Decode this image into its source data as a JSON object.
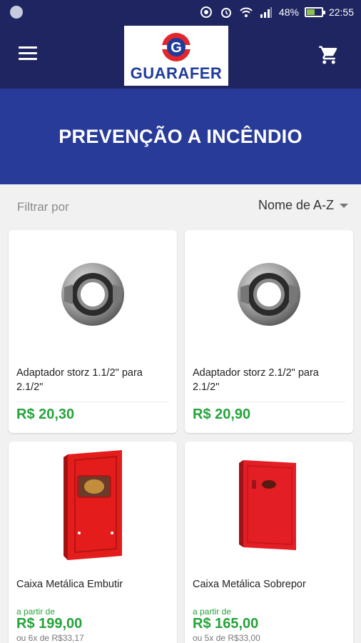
{
  "status_bar": {
    "battery": "48%",
    "time": "22:55"
  },
  "header": {
    "logo_text": "GUARAFER",
    "logo_colors": {
      "red": "#e3262b",
      "blue": "#1f3c9a"
    }
  },
  "hero": {
    "title": "PREVENÇÃO A INCÊNDIO"
  },
  "filter": {
    "label": "Filtrar por",
    "sort_value": "Nome de A-Z"
  },
  "products": [
    {
      "name": "Adaptador storz 1.1/2\" para 2.1/2\"",
      "price": "R$ 20,30"
    },
    {
      "name": "Adaptador storz 2.1/2\" para 2.1/2\"",
      "price": "R$ 20,90"
    },
    {
      "name": "Caixa Metálica Embutir",
      "from_label": "a partir de",
      "price": "R$ 199,00",
      "installments": "ou 6x de R$33,17"
    },
    {
      "name": "Caixa Metálica Sobrepor",
      "from_label": "a partir de",
      "price": "R$ 165,00",
      "installments": "ou 5x de R$33,00"
    }
  ],
  "colors": {
    "header_bg": "#1e2560",
    "hero_bg": "#283b99",
    "price_green": "#26a33a",
    "page_bg": "#f1f1f1"
  }
}
